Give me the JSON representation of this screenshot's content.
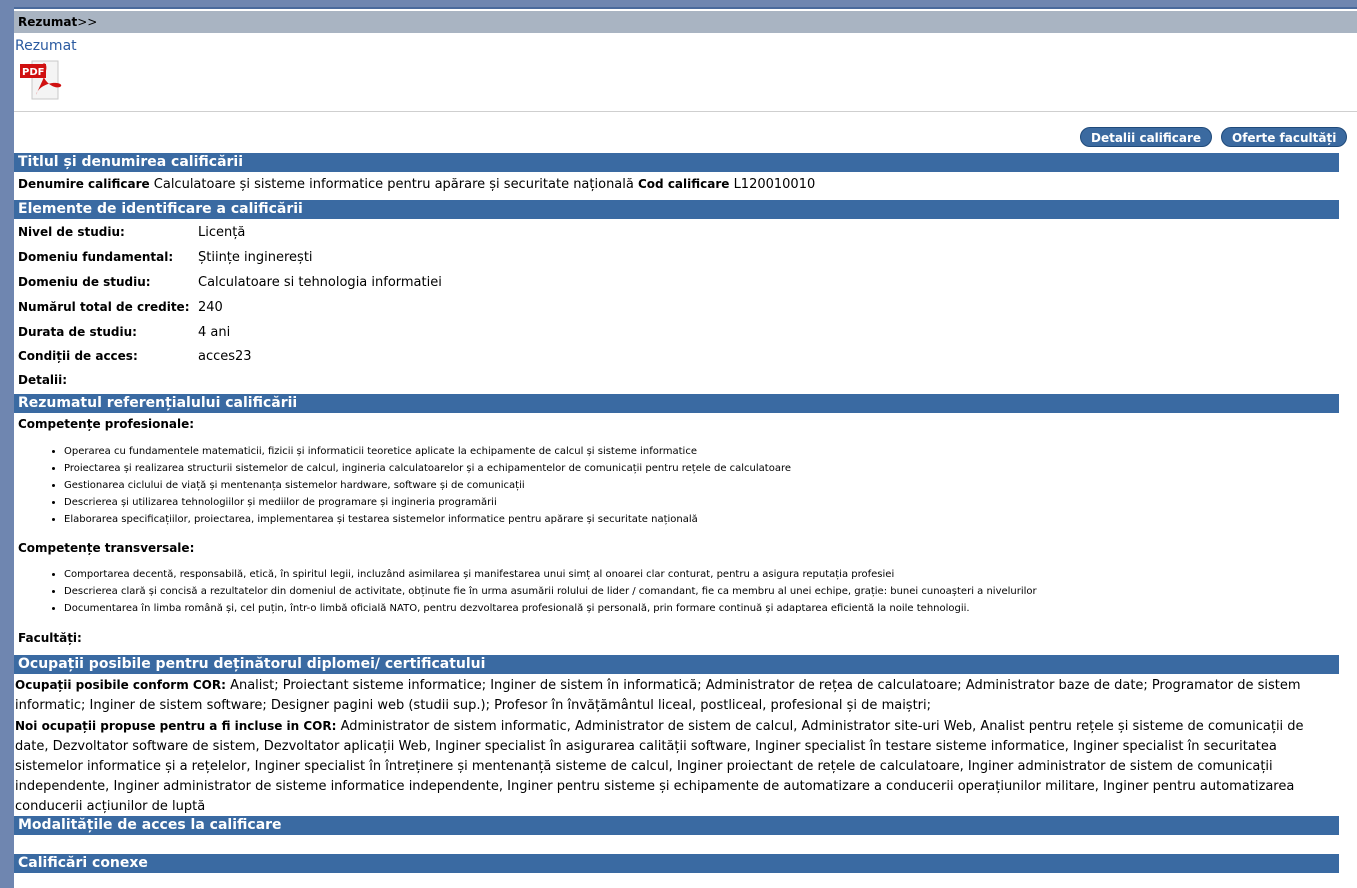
{
  "breadcrumb": {
    "label": "Rezumat",
    "arrows": ">>"
  },
  "rezumat_link": "Rezumat",
  "pdf_icon_label": "PDF",
  "buttons": {
    "detalii": "Detalii calificare",
    "oferte": "Oferte facultăți"
  },
  "sections": {
    "titlu": "Titlul și denumirea calificării",
    "elemente": "Elemente de identificare a calificării",
    "rezumat_ref": "Rezumatul referențialului calificării",
    "ocupatii": "Ocupații posibile pentru deținătorul diplomei/ certificatului",
    "modalitati": "Modalitățile de acces la calificare",
    "conexe": "Calificări conexe"
  },
  "title_row": {
    "denumire_label": "Denumire calificare",
    "denumire_value": "Calculatoare și sisteme informatice pentru apărare și securitate națională",
    "cod_label": "Cod calificare",
    "cod_value": "L120010010"
  },
  "fields": [
    {
      "label": "Nivel de studiu:",
      "value": "Licență"
    },
    {
      "label": "Domeniu fundamental:",
      "value": "Științe inginerești"
    },
    {
      "label": "Domeniu de studiu:",
      "value": "Calculatoare si tehnologia informatiei"
    },
    {
      "label": "Numărul total de credite:",
      "value": "240"
    },
    {
      "label": "Durata de studiu:",
      "value": "4 ani"
    },
    {
      "label": "Condiții de acces:",
      "value": "acces23"
    },
    {
      "label": "Detalii:",
      "value": ""
    }
  ],
  "competente_profesionale": {
    "heading": "Competențe profesionale:",
    "items": [
      "Operarea cu fundamentele matematicii, fizicii și informaticii teoretice aplicate la echipamente de calcul și sisteme informatice",
      "Proiectarea și realizarea structurii sistemelor de calcul, ingineria calculatoarelor și a echipamentelor de comunicații pentru rețele de calculatoare",
      "Gestionarea ciclului de viață și mentenanța sistemelor hardware, software și de comunicații",
      "Descrierea și utilizarea tehnologiilor și mediilor de programare și ingineria programării",
      "Elaborarea specificațiilor, proiectarea, implementarea și testarea sistemelor informatice pentru apărare și securitate națională"
    ]
  },
  "competente_transversale": {
    "heading": "Competențe transversale:",
    "items": [
      "Comportarea decentă, responsabilă, etică, în spiritul legii, incluzând asimilarea și manifestarea unui simț al onoarei clar conturat, pentru a asigura reputația profesiei",
      "Descrierea clară și concisă a rezultatelor din domeniul de activitate, obținute fie în urma asumării rolului de lider / comandant, fie ca membru al unei echipe, grație: bunei cunoașteri a nivelurilor",
      "Documentarea în limba română și, cel puțin, într-o limbă oficială NATO, pentru dezvoltarea profesională și personală, prin formare continuă și adaptarea eficientă la noile tehnologii."
    ]
  },
  "facultati_label": "Facultăți:",
  "ocupatii_cor": {
    "label": "Ocupații posibile conform COR:",
    "text": "Analist; Proiectant sisteme informatice; Inginer de sistem în informatică; Administrator de rețea de calculatoare; Administrator baze de date; Programator de sistem informatic; Inginer de sistem software; Designer pagini web (studii sup.); Profesor în învățământul liceal, postliceal, profesional și de maiștri;"
  },
  "ocupatii_noi": {
    "label": "Noi ocupații propuse pentru a fi incluse in COR:",
    "text": "Administrator de sistem informatic, Administrator de sistem de calcul, Administrator site-uri Web, Analist pentru rețele și sisteme de comunicații de date, Dezvoltator software de sistem, Dezvoltator aplicații Web, Inginer specialist în asigurarea calității software, Inginer specialist în testare sisteme informatice, Inginer specialist în securitatea sistemelor informatice și a rețelelor, Inginer specialist în întreținere și mentenanță sisteme de calcul, Inginer proiectant de rețele de calculatoare, Inginer administrator de sistem de comunicații independente, Inginer administrator de sisteme informatice independente, Inginer pentru sisteme și echipamente de automatizare a conducerii operațiunilor militare, Inginer pentru automatizarea conducerii acțiunilor de luptă"
  },
  "colors": {
    "section_bar": "#3a6aa2",
    "breadcrumb_bar": "#a9b4c2",
    "button": "#3b6aa0",
    "link": "#2a5aa0"
  }
}
